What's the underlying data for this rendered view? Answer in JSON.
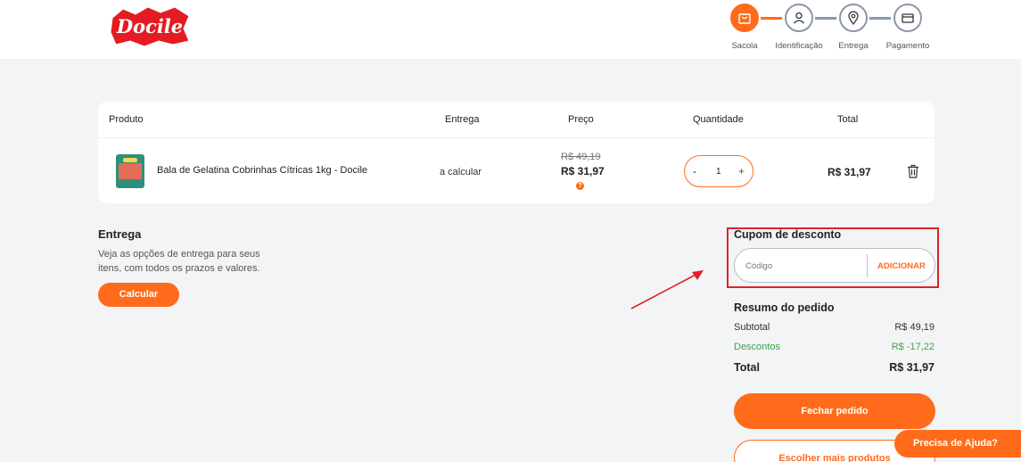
{
  "brand": {
    "logo_text": "Docile",
    "accent_color": "#ff6b1a",
    "logo_color": "#e41b23"
  },
  "steps": [
    {
      "label": "Sacola",
      "icon": "bag-icon",
      "active": true
    },
    {
      "label": "Identificação",
      "icon": "user-icon",
      "active": false
    },
    {
      "label": "Entrega",
      "icon": "location-pin-icon",
      "active": false
    },
    {
      "label": "Pagamento",
      "icon": "credit-card-icon",
      "active": false
    }
  ],
  "cart": {
    "headers": {
      "product": "Produto",
      "shipping": "Entrega",
      "price": "Preço",
      "quantity": "Quantidade",
      "total": "Total"
    },
    "item": {
      "name": "Bala de Gelatina Cobrinhas Cítricas 1kg - Docile",
      "shipping": "a calcular",
      "price_old": "R$ 49,19",
      "price_new": "R$ 31,97",
      "info_icon": "?",
      "quantity": "1",
      "minus": "-",
      "plus": "+",
      "total": "R$ 31,97"
    }
  },
  "shipping_section": {
    "title": "Entrega",
    "description": "Veja as opções de entrega para seus itens, com todos os prazos e valores.",
    "button": "Calcular"
  },
  "coupon": {
    "title": "Cupom de desconto",
    "placeholder": "Código",
    "button": "ADICIONAR"
  },
  "summary": {
    "title": "Resumo do pedido",
    "subtotal_label": "Subtotal",
    "subtotal_value": "R$ 49,19",
    "discount_label": "Descontos",
    "discount_value": "R$ -17,22",
    "total_label": "Total",
    "total_value": "R$ 31,97",
    "close_button": "Fechar pedido",
    "more_button": "Escolher mais produtos"
  },
  "help_button": "Precisa de Ajuda?"
}
